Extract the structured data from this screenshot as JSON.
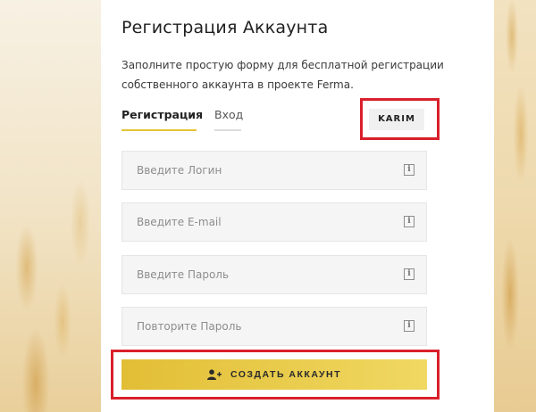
{
  "header": {
    "title": "Регистрация Аккаунта",
    "subtitle": "Заполните простую форму для бесплатной регистрации собственного аккаунта в проекте Ferma."
  },
  "tabs": [
    {
      "label": "Регистрация",
      "active": true
    },
    {
      "label": "Вход",
      "active": false
    }
  ],
  "user_badge": "KARIM",
  "fields": [
    {
      "placeholder": "Введите Логин",
      "value": "",
      "icon": "info-icon"
    },
    {
      "placeholder": "Введите E-mail",
      "value": "",
      "icon": "info-icon"
    },
    {
      "placeholder": "Введите Пароль",
      "value": "",
      "icon": "info-icon"
    },
    {
      "placeholder": "Повторите Пароль",
      "value": "",
      "icon": "info-icon"
    }
  ],
  "submit": {
    "label": "СОЗДАТЬ АККАУНТ",
    "icon": "add-user-icon"
  },
  "colors": {
    "accent": "#e6c235",
    "highlight": "#d9202b",
    "field_bg": "#f5f5f5"
  }
}
